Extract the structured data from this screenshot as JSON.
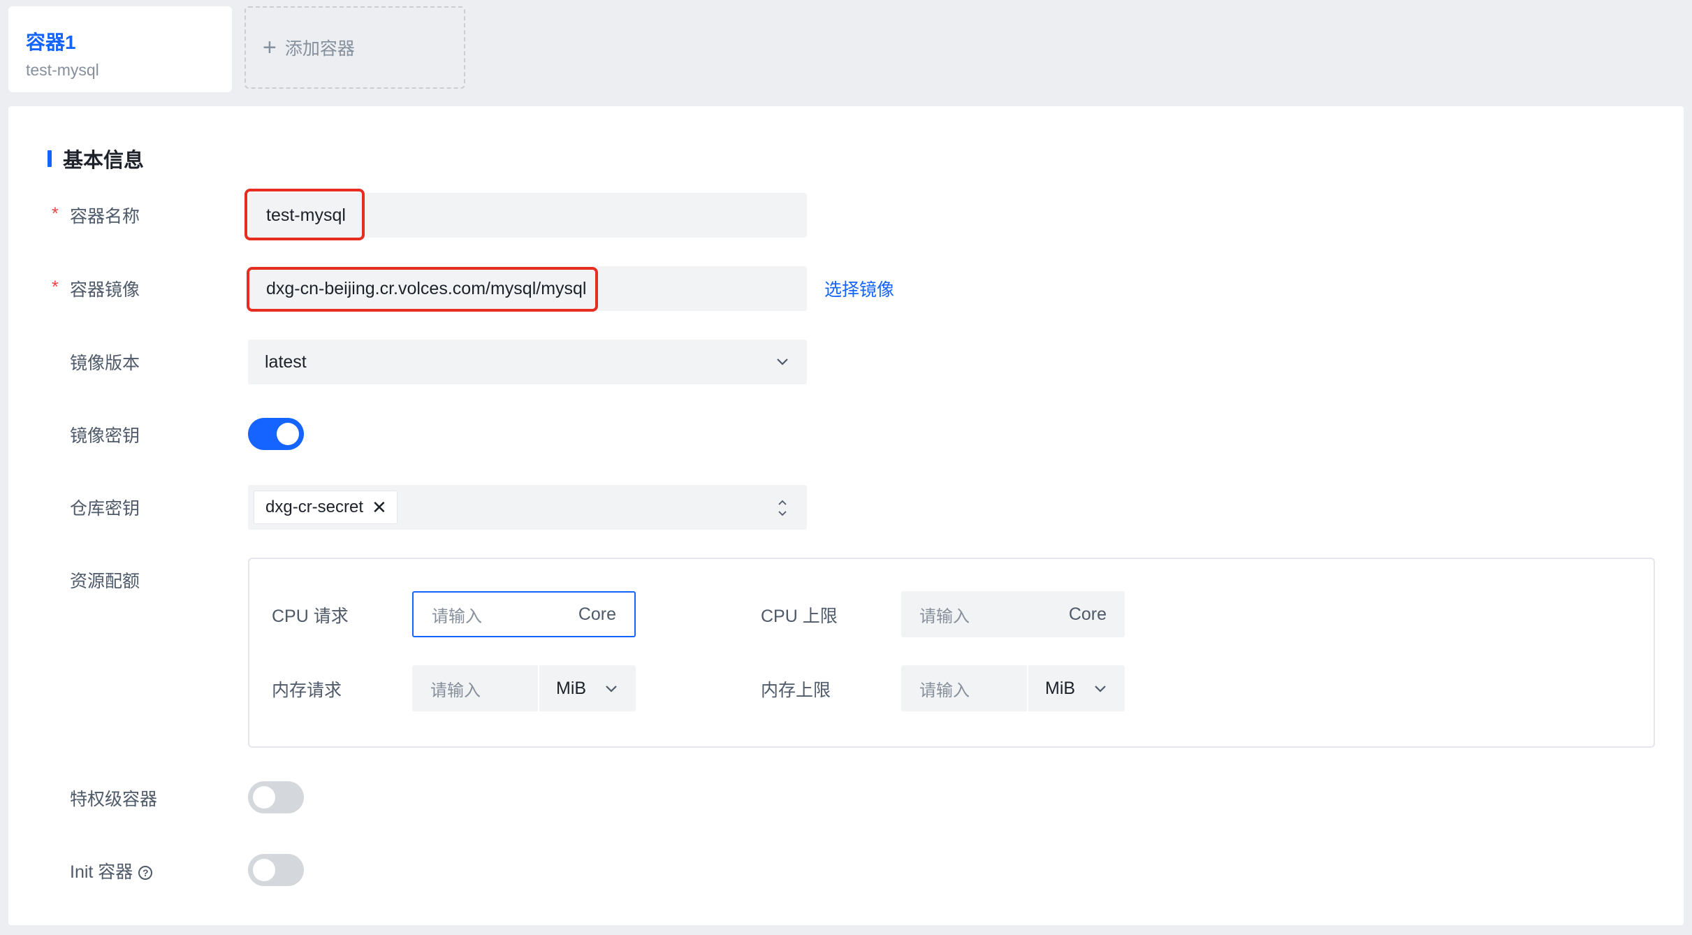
{
  "tabs": {
    "active": {
      "title": "容器1",
      "subtitle": "test-mysql"
    },
    "add_label": "添加容器"
  },
  "section": {
    "title": "基本信息"
  },
  "form": {
    "required_mark": "*",
    "container_name": {
      "label": "容器名称",
      "value": "test-mysql"
    },
    "container_image": {
      "label": "容器镜像",
      "value": "dxg-cn-beijing.cr.volces.com/mysql/mysql",
      "link": "选择镜像"
    },
    "image_version": {
      "label": "镜像版本",
      "value": "latest"
    },
    "image_secret": {
      "label": "镜像密钥",
      "enabled": true
    },
    "repo_secret": {
      "label": "仓库密钥",
      "tag": "dxg-cr-secret"
    },
    "resource_quota": {
      "label": "资源配额",
      "cpu_request": {
        "label": "CPU 请求",
        "placeholder": "请输入",
        "suffix": "Core"
      },
      "cpu_limit": {
        "label": "CPU 上限",
        "placeholder": "请输入",
        "suffix": "Core"
      },
      "mem_request": {
        "label": "内存请求",
        "placeholder": "请输入",
        "unit": "MiB"
      },
      "mem_limit": {
        "label": "内存上限",
        "placeholder": "请输入",
        "unit": "MiB"
      }
    },
    "privileged": {
      "label": "特权级容器",
      "enabled": false
    },
    "init_container": {
      "label": "Init 容器",
      "help": "?",
      "enabled": false
    }
  },
  "colors": {
    "accent": "#1664ff",
    "highlight": "#e52e1f",
    "required": "#f53f3f"
  }
}
